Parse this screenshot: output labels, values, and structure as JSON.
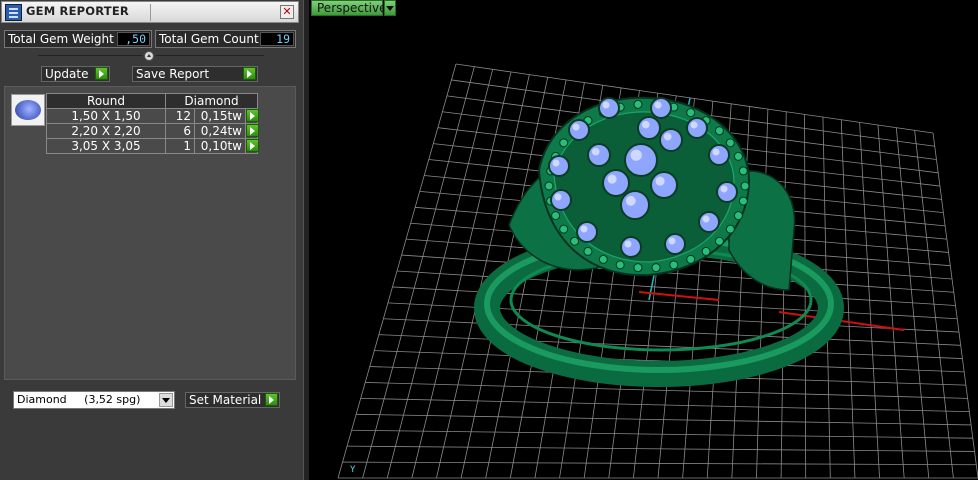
{
  "panel": {
    "title": "GEM REPORTER",
    "close_symbol": "✕",
    "total_weight_label": "Total Gem Weight",
    "total_weight_value": ",50",
    "total_count_label": "Total Gem Count",
    "total_count_value": "19",
    "update_label": "Update",
    "save_report_label": "Save Report",
    "table": {
      "headers": [
        "Round",
        "Diamond"
      ],
      "rows": [
        {
          "size": "1,50 X 1,50",
          "count": "12",
          "weight": "0,15tw"
        },
        {
          "size": "2,20 X 2,20",
          "count": "6",
          "weight": "0,24tw"
        },
        {
          "size": "3,05 X 3,05",
          "count": "1",
          "weight": "0,10tw"
        }
      ]
    },
    "material_select": "Diamond     (3,52 spg)",
    "set_material_label": "Set Material"
  },
  "viewport": {
    "view_label": "Perspective",
    "axis_label": "Y"
  },
  "colors": {
    "accent_green": "#4fb83a",
    "value_cyan": "#6fd2ff",
    "ring_green": "#0f7a4a",
    "gem_blue": "#8fa6ff",
    "axis_red": "#d01010"
  },
  "icons": [
    "app-gem-icon",
    "close-icon",
    "collapse-knob-icon",
    "play-arrow-icon",
    "dropdown-arrow-icon"
  ]
}
